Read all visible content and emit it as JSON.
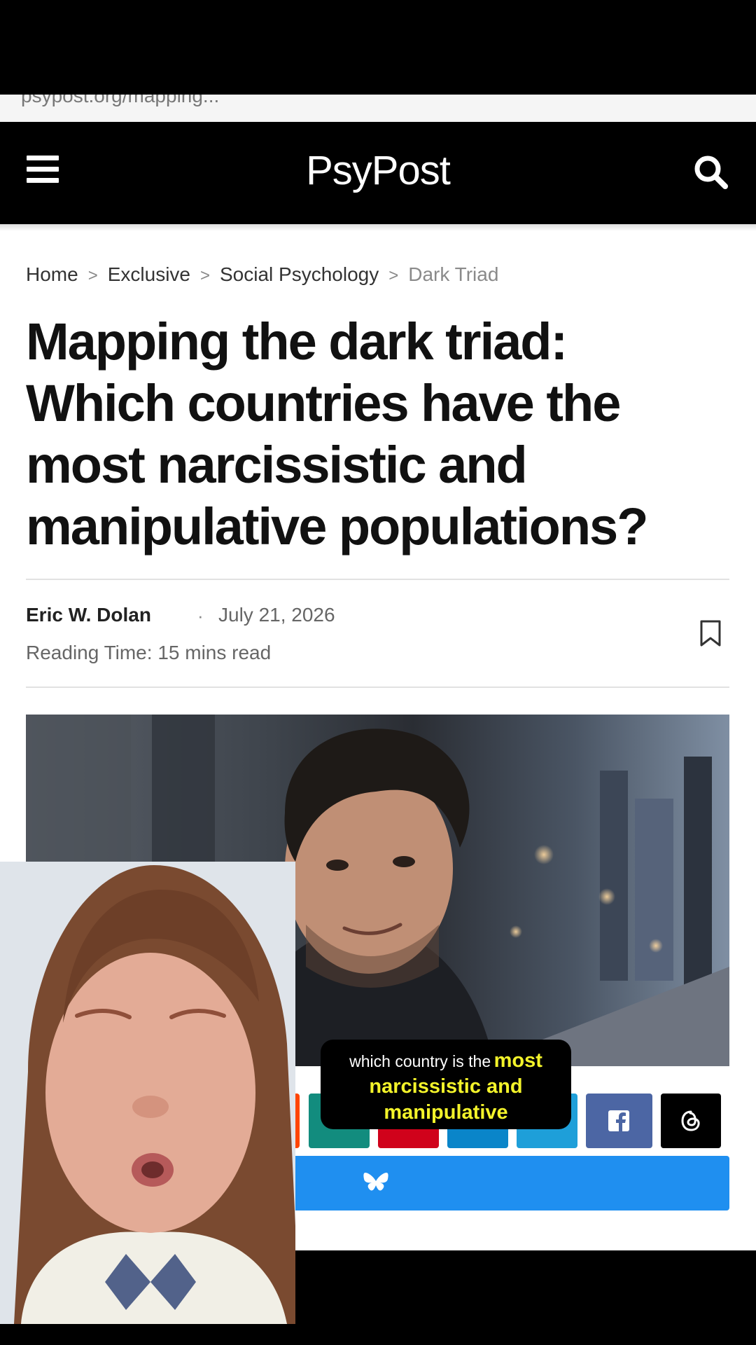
{
  "url_strip": {
    "fragment": "psypost.org/mapping..."
  },
  "header": {
    "logo": "PsyPost"
  },
  "breadcrumb": {
    "items": [
      "Home",
      "Exclusive",
      "Social Psychology"
    ],
    "current": "Dark Triad",
    "separator": ">"
  },
  "article": {
    "title": "Mapping the dark triad: Which countries have the most narcissistic and manipulative populations?",
    "author": "Eric W. Dolan",
    "dot": "·",
    "date": "July 21, 2026",
    "reading_time": "Reading Time: 15 mins read"
  },
  "share": {
    "buttons": [
      "reddit",
      "whatsapp",
      "pinterest",
      "linkedin",
      "telegram",
      "facebook",
      "threads",
      "bluesky"
    ],
    "colors": {
      "reddit": "#ff4500",
      "whatsapp": "#128c7e",
      "pinterest": "#d0021b",
      "linkedin": "#0a85c9",
      "telegram": "#1e9fd9",
      "facebook": "#4c66a4",
      "threads": "#000000",
      "bluesky": "#1f8ff0"
    }
  },
  "caption": {
    "plain": "which country is the",
    "highlight_1": "most",
    "highlight_2": "narcissistic and",
    "highlight_3": "manipulative"
  },
  "colors": {
    "header_bg": "#000000",
    "caption_highlight": "#f3f32a",
    "text": "#111111"
  }
}
